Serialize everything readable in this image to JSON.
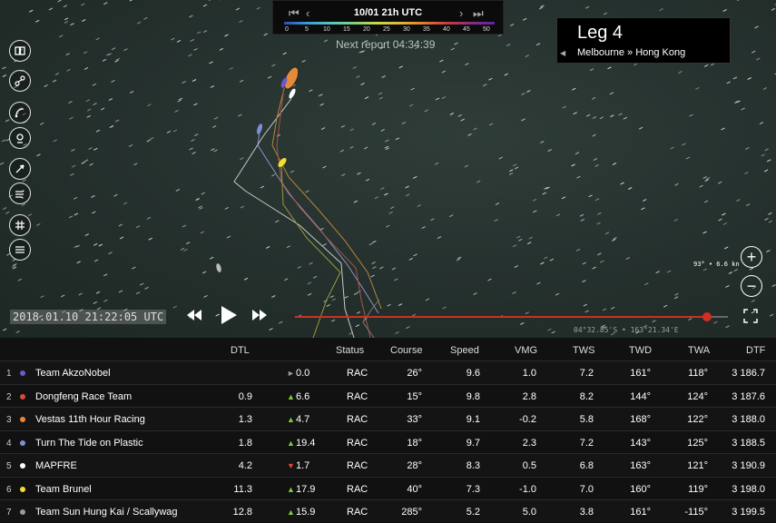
{
  "timebar": {
    "date": "10/01 21h UTC",
    "first": "⏮",
    "prev": "‹",
    "next": "›",
    "last": "⏭",
    "scale": [
      "0",
      "5",
      "10",
      "15",
      "20",
      "25",
      "30",
      "35",
      "40",
      "45",
      "50"
    ]
  },
  "next_report": "Next report 04:34:39",
  "leg": {
    "title": "Leg 4",
    "route": "Melbourne » Hong Kong",
    "arrow": "◀"
  },
  "wind_readout": "93° • 6.6 kn",
  "timestamp": "2018.01.10 21:22:05 UTC",
  "coords": "04°32.85'S • 163°21.34'E",
  "playback": {
    "position": 0.956
  },
  "table": {
    "headers": {
      "dtl": "DTL",
      "status": "Status",
      "course": "Course",
      "speed": "Speed",
      "vmg": "VMG",
      "tws": "TWS",
      "twd": "TWD",
      "twa": "TWA",
      "dtf": "DTF"
    },
    "rows": [
      {
        "rank": "1",
        "team": "Team AkzoNobel",
        "color": "#6a5acd",
        "dtl": "",
        "trend": "►",
        "trend_color": "#999",
        "change": "0.0",
        "status": "RAC",
        "course": "26°",
        "speed": "9.6",
        "vmg": "1.0",
        "tws": "7.2",
        "twd": "161°",
        "twa": "118°",
        "dtf": "3 186.7"
      },
      {
        "rank": "2",
        "team": "Dongfeng Race Team",
        "color": "#d84a3a",
        "dtl": "0.9",
        "trend": "▲",
        "trend_color": "#7bd13a",
        "change": "6.6",
        "status": "RAC",
        "course": "15°",
        "speed": "9.8",
        "vmg": "2.8",
        "tws": "8.2",
        "twd": "144°",
        "twa": "124°",
        "dtf": "3 187.6"
      },
      {
        "rank": "3",
        "team": "Vestas 11th Hour Racing",
        "color": "#e5893a",
        "dtl": "1.3",
        "trend": "▲",
        "trend_color": "#7bd13a",
        "change": "4.7",
        "status": "RAC",
        "course": "33°",
        "speed": "9.1",
        "vmg": "-0.2",
        "tws": "5.8",
        "twd": "168°",
        "twa": "122°",
        "dtf": "3 188.0"
      },
      {
        "rank": "4",
        "team": "Turn The Tide on Plastic",
        "color": "#7f8fd8",
        "dtl": "1.8",
        "trend": "▲",
        "trend_color": "#7bd13a",
        "change": "19.4",
        "status": "RAC",
        "course": "18°",
        "speed": "9.7",
        "vmg": "2.3",
        "tws": "7.2",
        "twd": "143°",
        "twa": "125°",
        "dtf": "3 188.5"
      },
      {
        "rank": "5",
        "team": "MAPFRE",
        "color": "#ffffff",
        "dtl": "4.2",
        "trend": "▼",
        "trend_color": "#e0463a",
        "change": "1.7",
        "status": "RAC",
        "course": "28°",
        "speed": "8.3",
        "vmg": "0.5",
        "tws": "6.8",
        "twd": "163°",
        "twa": "121°",
        "dtf": "3 190.9"
      },
      {
        "rank": "6",
        "team": "Team Brunel",
        "color": "#f0e030",
        "dtl": "11.3",
        "trend": "▲",
        "trend_color": "#7bd13a",
        "change": "17.9",
        "status": "RAC",
        "course": "40°",
        "speed": "7.3",
        "vmg": "-1.0",
        "tws": "7.0",
        "twd": "160°",
        "twa": "119°",
        "dtf": "3 198.0"
      },
      {
        "rank": "7",
        "team": "Team Sun Hung Kai / Scallywag",
        "color": "#9a9a9a",
        "dtl": "12.8",
        "trend": "▲",
        "trend_color": "#7bd13a",
        "change": "15.9",
        "status": "RAC",
        "course": "285°",
        "speed": "5.2",
        "vmg": "5.0",
        "tws": "3.8",
        "twd": "161°",
        "twa": "-115°",
        "dtf": "3 199.5"
      }
    ]
  }
}
